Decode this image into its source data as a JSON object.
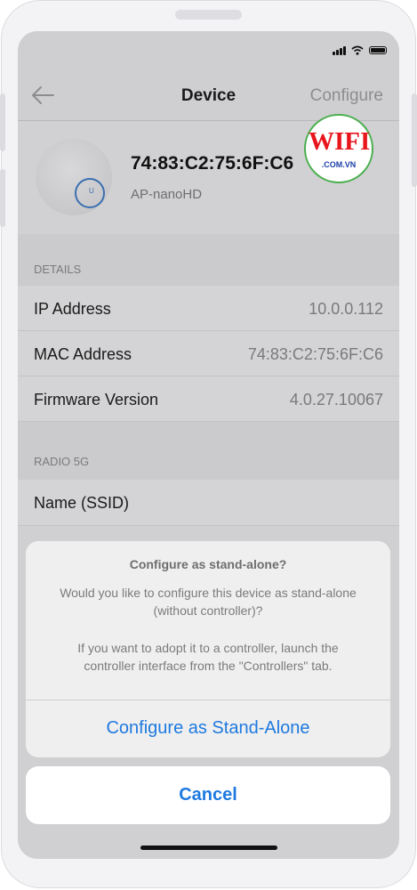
{
  "nav": {
    "title": "Device",
    "configure": "Configure"
  },
  "device": {
    "mac": "74:83:C2:75:6F:C6",
    "model": "AP-nanoHD"
  },
  "watermark": {
    "line1": "WIFI",
    "line2": ".COM.VN"
  },
  "details": {
    "header": "DETAILS",
    "rows": [
      {
        "label": "IP Address",
        "value": "10.0.0.112"
      },
      {
        "label": "MAC Address",
        "value": "74:83:C2:75:6F:C6"
      },
      {
        "label": "Firmware Version",
        "value": "4.0.27.10067"
      }
    ]
  },
  "radio": {
    "header": "RADIO 5G",
    "ssid_label": "Name (SSID)"
  },
  "dialog": {
    "title": "Configure as stand-alone?",
    "message1": "Would you like to configure this device as stand-alone (without controller)?",
    "message2": "If you want to adopt it to a controller, launch the controller interface from the \"Controllers\" tab.",
    "action": "Configure as Stand-Alone",
    "cancel": "Cancel"
  },
  "colors": {
    "accent": "#1f7ae0",
    "logo_red": "#e8161c"
  }
}
